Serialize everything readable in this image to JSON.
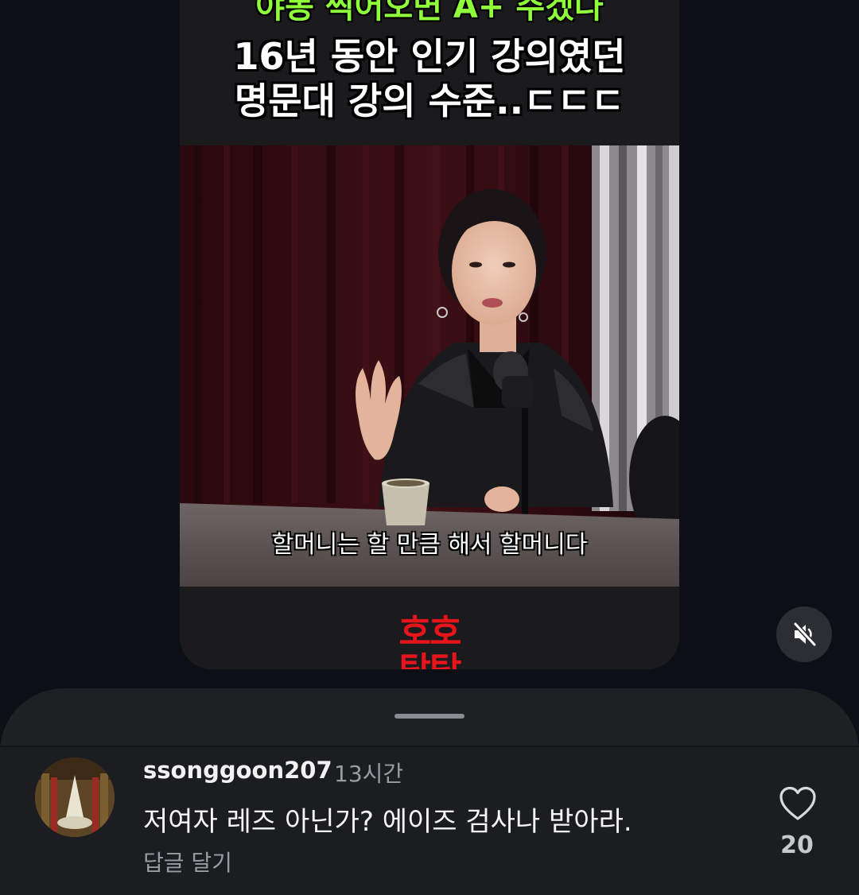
{
  "video": {
    "caption_top": "야동 찍어오면 A+ 주겠다",
    "caption_line1": "16년 동안 인기 강의였던",
    "caption_line2": "명문대 강의 수준..ㄷㄷㄷ",
    "subtitle": "할머니는 할 만큼 해서 할머니다",
    "channel_logo": "호호\n탐탐"
  },
  "controls": {
    "mute_icon": "volume-muted-icon"
  },
  "comment": {
    "username": "ssonggoon207",
    "time": "13시간",
    "text": "저여자 레즈 아닌가? 에이즈 검사나 받아라.",
    "reply_label": "답글 달기",
    "like_icon": "heart-outline-icon",
    "like_count": "20"
  },
  "colors": {
    "background": "#0c0f16",
    "sheet": "#1f2024",
    "caption_green": "#8fff3a",
    "logo_red": "#e8141c"
  }
}
